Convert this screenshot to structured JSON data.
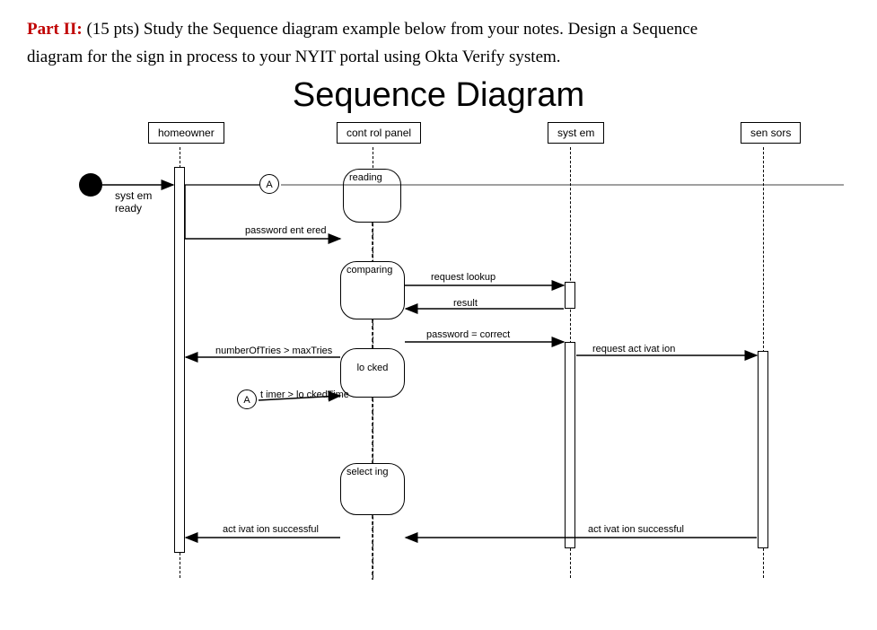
{
  "question": {
    "partLabel": "Part II:",
    "partPoints": "(15 pts)",
    "text1": "Study the Sequence diagram example below from your notes. Design a Sequence",
    "text2": "diagram for the sign in process to your NYIT portal using Okta Verify system."
  },
  "title": "Sequence Diagram",
  "participants": {
    "homeowner": "homeowner",
    "controlPanel": "cont rol panel",
    "system": "syst em",
    "sensors": "sen sors"
  },
  "startNote": {
    "line1": "syst em",
    "line2": "ready"
  },
  "connectors": {
    "a1": "A",
    "a2": "A"
  },
  "states": {
    "reading": "reading",
    "comparing": "comparing",
    "locked": "lo cked",
    "selecting": "select ing"
  },
  "messages": {
    "passwordEntered": "password ent ered",
    "requestLookup": "request  lookup",
    "result": "result",
    "passwordCorrect": "password = correct",
    "numberTries": "numberOfTries > maxTries",
    "requestActivation": "request act ivat ion",
    "timerLocked": "t imer > lo ckedTime",
    "activationSuccessful1": "act ivat ion successful",
    "activationSuccessful2": "act ivat ion successful"
  }
}
